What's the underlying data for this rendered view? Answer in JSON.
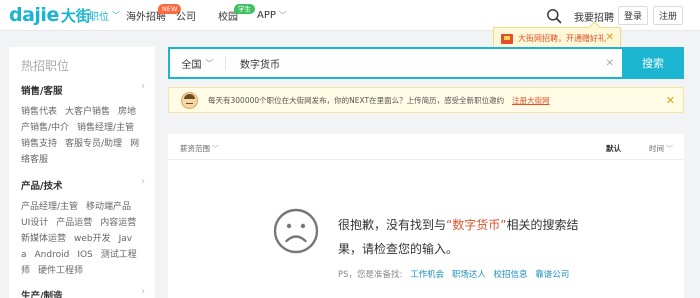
{
  "header": {
    "logo_text": "dajie",
    "logo_cn": "大街",
    "nav": [
      {
        "label": "职位",
        "active": true,
        "has_chevron": true
      },
      {
        "label": "海外招聘",
        "active": false,
        "has_chevron": false,
        "badge": "NEW"
      },
      {
        "label": "公司",
        "active": false,
        "has_chevron": false
      },
      {
        "label": "校园",
        "active": false,
        "has_chevron": true,
        "badge": "学生"
      },
      {
        "label": "APP",
        "active": false,
        "has_chevron": true
      }
    ],
    "hire_link": "我要招聘",
    "login": "登录",
    "register": "注册"
  },
  "promo": {
    "text": "大街网招聘，开通赠好礼",
    "close": "✕"
  },
  "sidebar": {
    "title": "热招职位",
    "categories": [
      {
        "name": "销售/客服",
        "items": [
          "销售代表",
          "大客户销售",
          "房地产销售/中介",
          "销售经理/主管",
          "销售支持",
          "客服专员/助理",
          "网络客服"
        ]
      },
      {
        "name": "产品/技术",
        "items": [
          "产品经理/主管",
          "移动端产品",
          "UI设计",
          "产品运营",
          "内容运营",
          "新媒体运营",
          "web开发",
          "Java",
          "Android",
          "IOS",
          "测试工程师",
          "硬件工程师"
        ]
      },
      {
        "name": "生产/制造",
        "items": []
      }
    ],
    "arrow": "›"
  },
  "search": {
    "city": "全国",
    "keyword": "数字货币",
    "clear": "✕",
    "button": "搜索"
  },
  "notice": {
    "text": "每天有300000个职位在大街网发布，你的NEXT在里面么？上传简历，感受全新职位邀约",
    "link": "注册大街网",
    "close": "✕"
  },
  "results": {
    "salary_filter": "薪资范围",
    "sort_default": "默认",
    "sort_time": "时间",
    "empty_prefix": "很抱歉，没有找到与",
    "empty_keyword": "“数字货币”",
    "empty_suffix": "相关的搜索结果，请检查您的输入。",
    "tips_label": "PS，您是准备找:",
    "tips": [
      "工作机会",
      "职场达人",
      "校招信息",
      "靠谱公司"
    ]
  },
  "colors": {
    "brand": "#1bb5d2",
    "accent": "#e0502a",
    "new_badge": "#ff6a3d",
    "student_badge": "#40c063"
  }
}
